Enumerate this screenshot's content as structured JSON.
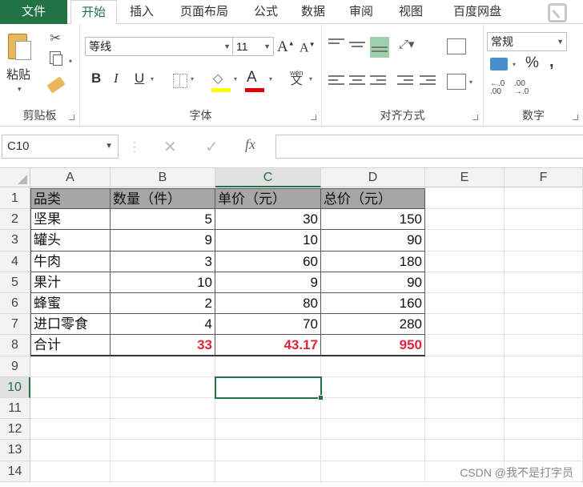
{
  "tabs": [
    {
      "label": "文件"
    },
    {
      "label": "开始"
    },
    {
      "label": "插入"
    },
    {
      "label": "页面布局"
    },
    {
      "label": "公式"
    },
    {
      "label": "数据"
    },
    {
      "label": "审阅"
    },
    {
      "label": "视图"
    },
    {
      "label": "百度网盘"
    }
  ],
  "ribbon": {
    "clipboard": {
      "paste_label": "粘贴",
      "group_label": "剪贴板"
    },
    "font": {
      "font_name": "等线",
      "font_size": "11",
      "group_label": "字体",
      "bold": "B",
      "italic": "I",
      "underline": "U",
      "grow": "A",
      "shrink": "A",
      "color_letter": "A",
      "phonetic_top": "wén",
      "phonetic_bottom": "文"
    },
    "alignment": {
      "group_label": "对齐方式"
    },
    "number": {
      "format": "常规",
      "group_label": "数字",
      "percent": "%",
      "comma": ",",
      "inc_decimal": "←.0\n.00",
      "dec_decimal": ".00\n→.0"
    }
  },
  "formula_bar": {
    "name_box": "C10",
    "cancel": "✕",
    "enter": "✓",
    "fx": "fx",
    "content": ""
  },
  "columns": [
    "A",
    "B",
    "C",
    "D",
    "E",
    "F"
  ],
  "rows": [
    "1",
    "2",
    "3",
    "4",
    "5",
    "6",
    "7",
    "8",
    "9",
    "10",
    "11",
    "12",
    "13",
    "14"
  ],
  "table": {
    "header": [
      "品类",
      "数量（件）",
      "单价（元）",
      "总价（元）"
    ],
    "rows": [
      [
        "坚果",
        "5",
        "30",
        "150"
      ],
      [
        "罐头",
        "9",
        "10",
        "90"
      ],
      [
        "牛肉",
        "3",
        "60",
        "180"
      ],
      [
        "果汁",
        "10",
        "9",
        "90"
      ],
      [
        "蜂蜜",
        "2",
        "80",
        "160"
      ],
      [
        "进口零食",
        "4",
        "70",
        "280"
      ]
    ],
    "total": [
      "合计",
      "33",
      "43.17",
      "950"
    ]
  },
  "selected_cell": "C10",
  "watermark": "CSDN @我不是打字员",
  "colors": {
    "excel_green": "#217346",
    "header_fill": "#a6a6a6",
    "total_red": "#e0233a"
  }
}
